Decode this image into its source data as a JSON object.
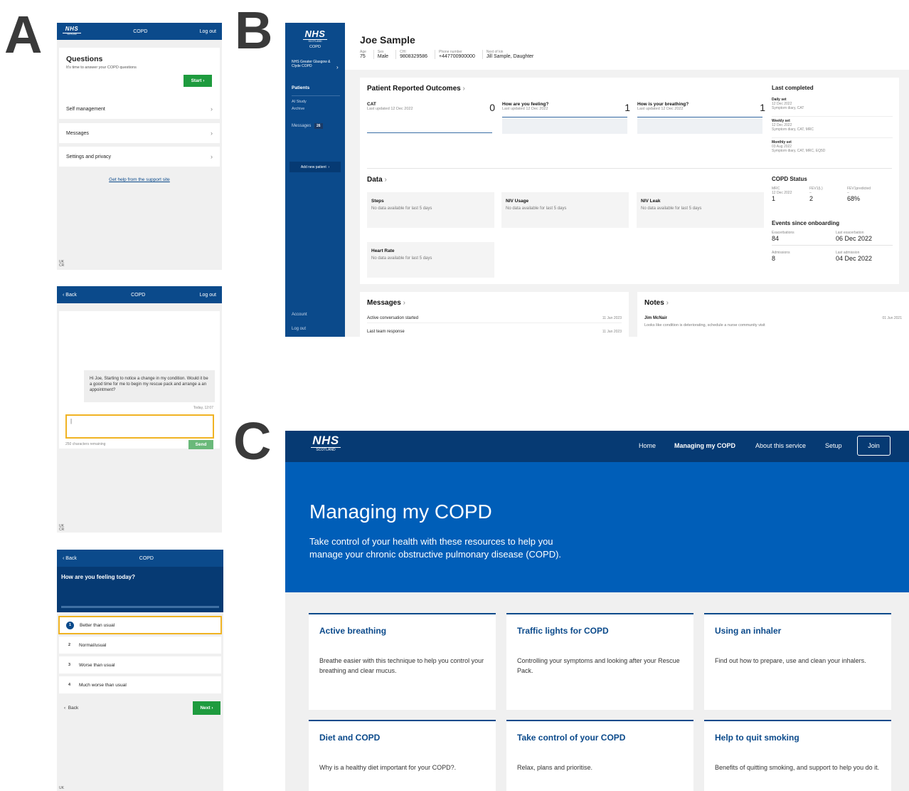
{
  "labels": {
    "a": "A",
    "b": "B",
    "c": "C"
  },
  "logo": {
    "word": "NHS",
    "sub": "SCOTLAND"
  },
  "panelA": {
    "screen1": {
      "header": {
        "logo_sub": "SCOTLAND",
        "title": "COPD",
        "logout": "Log out"
      },
      "questions": {
        "title": "Questions",
        "subtitle": "It's time to answer your COPD questions",
        "start": "Start"
      },
      "menu": [
        "Self management",
        "Messages",
        "Settings and privacy"
      ],
      "help_link": "Get help from the support site",
      "lang": [
        "UK",
        "CR"
      ]
    },
    "screen2": {
      "header": {
        "back": "Back",
        "title": "COPD",
        "logout": "Log out"
      },
      "message": "Hi Joe, Starting to notice a change in my condition. Would it be a good time for me to begin my rescue pack and arrange a an appointment?",
      "timestamp": "Today, 12:07",
      "input_value": "|",
      "chars_remaining": "250 characters remaining",
      "send": "Send",
      "lang": [
        "UK",
        "CR"
      ]
    },
    "screen3": {
      "header": {
        "back": "Back",
        "title": "COPD"
      },
      "question": "How are you feeling today?",
      "options": [
        {
          "num": "1",
          "label": "Better than usual"
        },
        {
          "num": "2",
          "label": "Normal/usual"
        },
        {
          "num": "3",
          "label": "Worse than usual"
        },
        {
          "num": "4",
          "label": "Much worse than usual"
        }
      ],
      "back": "Back",
      "next": "Next",
      "lang": [
        "UK"
      ]
    }
  },
  "panelB": {
    "sidebar": {
      "logo_sub1": "SCOTLAND",
      "logo_sub2": "COPD",
      "org": "NHS Greater Glasgow & Clyde COPD",
      "patients": "Patients",
      "ai_study": "AI Study",
      "archive": "Archive",
      "messages": "Messages",
      "messages_count": "26",
      "add_patient": "Add new patient",
      "account": "Account",
      "logout": "Log out"
    },
    "patient": {
      "name": "Joe Sample",
      "fields": [
        {
          "label": "Age",
          "value": "75"
        },
        {
          "label": "Sex",
          "value": "Male"
        },
        {
          "label": "CHI",
          "value": "9808329586"
        },
        {
          "label": "Phone number",
          "value": "+447700900000"
        },
        {
          "label": "Next of kin",
          "value": "Jill Sample, Daughter"
        }
      ]
    },
    "pro": {
      "title": "Patient Reported Outcomes",
      "items": [
        {
          "name": "CAT",
          "updated": "Last updated 12 Dec 2022",
          "value": "0"
        },
        {
          "name": "How are you feeling?",
          "updated": "Last updated 12 Dec 2022",
          "value": "1"
        },
        {
          "name": "How is your breathing?",
          "updated": "Last updated 12 Dec 2022",
          "value": "1"
        }
      ]
    },
    "last_completed": {
      "title": "Last completed",
      "sets": [
        {
          "name": "Daily set",
          "date": "12 Dec 2022",
          "items": "Symptom diary, CAT"
        },
        {
          "name": "Weekly set",
          "date": "12 Dec 2022",
          "items": "Symptom diary, CAT, MRC"
        },
        {
          "name": "Monthly set",
          "date": "03 Aug 2022",
          "items": "Symptom diary, CAT, MRC, EQ5D"
        }
      ]
    },
    "data": {
      "title": "Data",
      "boxes": [
        {
          "name": "Steps",
          "text": "No data available for last 5 days"
        },
        {
          "name": "NIV Usage",
          "text": "No data available for last 5 days"
        },
        {
          "name": "NIV Leak",
          "text": "No data available for last 5 days"
        },
        {
          "name": "Heart Rate",
          "text": "No data available for last 5 days"
        }
      ]
    },
    "copd_status": {
      "title": "COPD Status",
      "mrc_label": "MRC",
      "mrc_date": "12 Dec 2022",
      "mrc": "1",
      "fev1_label": "FEV1(L)",
      "fev1_dash": "–",
      "fev1": "2",
      "fev1p_label": "FEV1predicted",
      "fev1p_dash": "–",
      "fev1p": "68%"
    },
    "events": {
      "title": "Events since onboarding",
      "exac_label": "Exacerbations",
      "exac": "84",
      "last_exac_label": "Last exacerbation",
      "last_exac": "06 Dec 2022",
      "adm_label": "Admissions",
      "adm": "8",
      "last_adm_label": "Last admission",
      "last_adm": "04 Dec 2022"
    },
    "messages": {
      "title": "Messages",
      "items": [
        {
          "text": "Active conversation started",
          "date": "11 Jan 2023"
        },
        {
          "text": "Last team response",
          "date": "11 Jan 2023"
        }
      ]
    },
    "notes": {
      "title": "Notes",
      "author": "Jim McNair",
      "date": "01 Jun 2021",
      "text": "Looks like condition is deteriorating, schedule a nurse community visit"
    }
  },
  "panelC": {
    "nav": {
      "home": "Home",
      "managing": "Managing my COPD",
      "about": "About this service",
      "setup": "Setup",
      "join": "Join"
    },
    "hero": {
      "title": "Managing my COPD",
      "subtitle1": "Take control of your health with these resources to help you",
      "subtitle2": "manage your chronic obstructive pulmonary disease (COPD)."
    },
    "cards": [
      {
        "title": "Active breathing",
        "text": "Breathe easier with this technique to help you control your breathing and clear mucus."
      },
      {
        "title": "Traffic lights for COPD",
        "text": "Controlling your symptoms and looking after your Rescue Pack."
      },
      {
        "title": "Using an inhaler",
        "text": "Find out how to prepare, use and clean your inhalers."
      },
      {
        "title": "Diet and COPD",
        "text": "Why is a healthy diet important for your COPD?."
      },
      {
        "title": "Take control of your COPD",
        "text": "Relax, plans and prioritise."
      },
      {
        "title": "Help to quit smoking",
        "text": "Benefits of quitting smoking, and support to help you do it."
      }
    ]
  }
}
